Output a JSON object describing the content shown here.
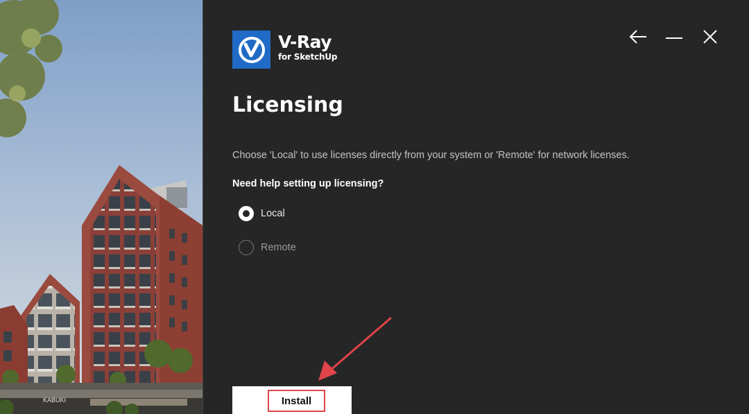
{
  "logo": {
    "product": "V-Ray",
    "subtitle": "for SketchUp",
    "brand_color": "#1f6bc7"
  },
  "window_controls": [
    "back-icon",
    "minimize-icon",
    "close-icon"
  ],
  "page": {
    "title": "Licensing",
    "description": "Choose 'Local' to use licenses directly from your system or 'Remote' for network licenses.",
    "help_link": "Need help setting up licensing?"
  },
  "license_options": [
    {
      "label": "Local",
      "selected": true
    },
    {
      "label": "Remote",
      "selected": false
    }
  ],
  "actions": {
    "install_label": "Install"
  },
  "photo": {
    "building_sign": "KABUKI"
  },
  "colors": {
    "background": "#262626",
    "annotation": "#e0434a"
  }
}
